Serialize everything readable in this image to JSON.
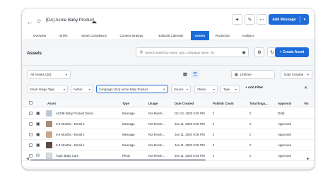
{
  "header": {
    "title": "[DA] Acme Baby Product",
    "back_icon": "back-arrow-icon",
    "star_icon": "star-icon",
    "cloud_icon": "cloud-upload-icon",
    "tool_icons": [
      "magic-wand-icon",
      "pencil-icon",
      "more-icon"
    ],
    "add_message_label": "Add Message",
    "add_message_caret": "▾"
  },
  "tabs": [
    {
      "label": "Overview",
      "active": false
    },
    {
      "label": "Briefs",
      "active": false
    },
    {
      "label": "Smart Compliance",
      "active": false
    },
    {
      "label": "Content Strategy",
      "active": false
    },
    {
      "label": "Editorial Calendar",
      "active": false
    },
    {
      "label": "Assets",
      "active": true
    },
    {
      "label": "Production",
      "active": false
    },
    {
      "label": "Analytics",
      "active": false
    }
  ],
  "toolbar": {
    "section_title": "Assets",
    "search_placeholder": "Search assets by name, type, campaign name, etc",
    "create_label": "+ Create Asset"
  },
  "view": {
    "all_assets": "All Assets (26)",
    "lifetime": "Lifetime",
    "sort": "Date Created"
  },
  "filters": [
    {
      "label": "Smart Image Tags",
      "selected": false
    },
    {
      "label": "Author",
      "selected": false
    },
    {
      "label": "Campaign: [DA] Acme Baby Product",
      "selected": true,
      "removable": true
    },
    {
      "label": "Source",
      "selected": false
    },
    {
      "label": "Status",
      "selected": false
    },
    {
      "label": "Type",
      "selected": false
    }
  ],
  "add_filter_label": "+ Add Filter",
  "table": {
    "columns": [
      "Asset",
      "Type",
      "Usage",
      "Date Created",
      "Publish Count",
      "Total Enga...",
      "Approval",
      "Vis"
    ],
    "rows": [
      {
        "icon": "layout-icon",
        "asset": "ACME Baby Product Demo",
        "type": "Message",
        "usage": "Not Restri...",
        "date": "Oct 12, 2020 5:00 PM",
        "publish": "0",
        "engagement": "0",
        "approval": "Draft",
        "thumb": "#b9c7d6"
      },
      {
        "icon": "layout-icon",
        "asset": "0-3 Months - Email 3",
        "type": "Message",
        "usage": "Not Restri...",
        "date": "Jun 11, 2020 9:05 PM",
        "publish": "0",
        "engagement": "0",
        "approval": "Approved",
        "thumb": "#a58d7a"
      },
      {
        "icon": "layout-icon",
        "asset": "0-3 Months - Email 2",
        "type": "Message",
        "usage": "Not Restri...",
        "date": "Jun 11, 2020 9:05 PM",
        "publish": "0",
        "engagement": "0",
        "approval": "Approved",
        "thumb": "#caa58c"
      },
      {
        "icon": "layout-icon",
        "asset": "0-3 Months - Email 1",
        "type": "Message",
        "usage": "Not Restri...",
        "date": "Jun 11, 2020 9:05 PM",
        "publish": "0",
        "engagement": "0",
        "approval": "Approved",
        "thumb": "#5a4a42"
      },
      {
        "icon": "image-icon",
        "asset": "Topic Baby Care",
        "type": "Photo",
        "usage": "Not Restri...",
        "date": "Jun 11, 2020 8:26 PM",
        "publish": "0",
        "engagement": "0",
        "approval": "Approved",
        "thumb": "#d8dde3"
      }
    ]
  },
  "colors": {
    "accent": "#1d6bd8",
    "background": "#f4f6f8"
  }
}
